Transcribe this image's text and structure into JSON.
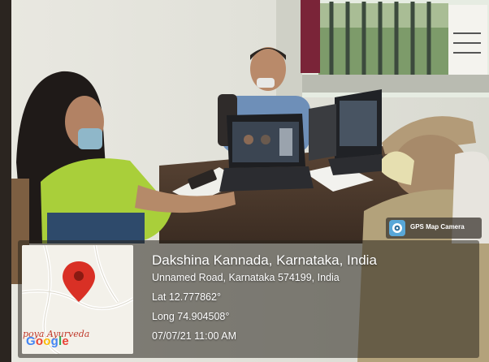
{
  "geotag": {
    "title": "Dakshina Kannada, Karnataka, India",
    "address": "Unnamed Road, Karnataka 574199, India",
    "lat": "Lat 12.777862°",
    "long": "Long 74.904508°",
    "timestamp": "07/07/21 11:00 AM"
  },
  "map": {
    "place_label": "poya Ayurveda",
    "logo_letters": [
      "G",
      "o",
      "o",
      "g",
      "l",
      "e"
    ],
    "pin_color": "#d93025"
  },
  "badge": {
    "label": "GPS Map Camera",
    "icon": "gps-map-camera-icon"
  },
  "colors": {
    "overlay": "#3a342c",
    "text": "#ffffff"
  }
}
